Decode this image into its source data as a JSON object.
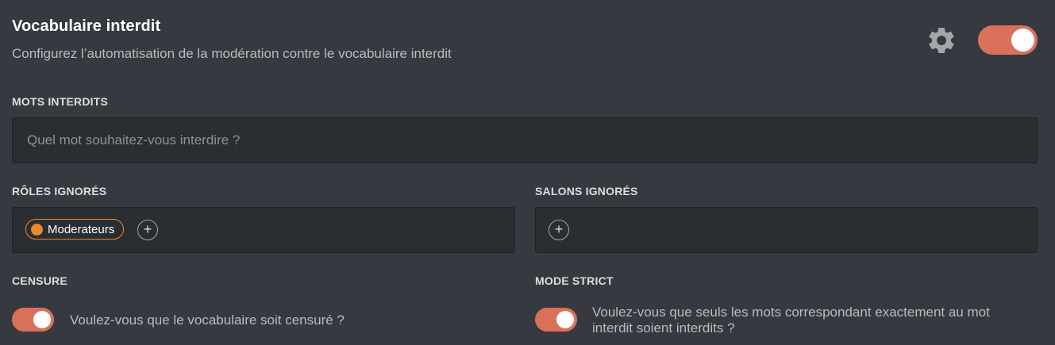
{
  "header": {
    "title": "Vocabulaire interdit",
    "subtitle": "Configurez l’automatisation de la modération contre le vocabulaire interdit",
    "enabled": true
  },
  "words": {
    "label": "MOTS INTERDITS",
    "placeholder": "Quel mot souhaitez-vous interdire ?",
    "value": ""
  },
  "ignored_roles": {
    "label": "RÔLES IGNORÉS",
    "items": [
      {
        "name": "Moderateurs",
        "color": "#e8892f"
      }
    ],
    "add_label": "+"
  },
  "ignored_channels": {
    "label": "SALONS IGNORÉS",
    "items": [],
    "add_label": "+"
  },
  "censor": {
    "label": "CENSURE",
    "description": "Voulez-vous que le vocabulaire soit censuré ?",
    "enabled": true
  },
  "strict_mode": {
    "label": "MODE STRICT",
    "description_line1": "Voulez-vous que seuls les mots correspondant exactement au mot",
    "description_line2": "interdit soient interdits ?",
    "enabled": true
  },
  "colors": {
    "accent": "#d9715a",
    "background": "#36393f",
    "input_background": "#2a2d31",
    "role_color": "#e8892f"
  },
  "icons": {
    "settings": "gear-icon",
    "add": "plus-icon"
  }
}
